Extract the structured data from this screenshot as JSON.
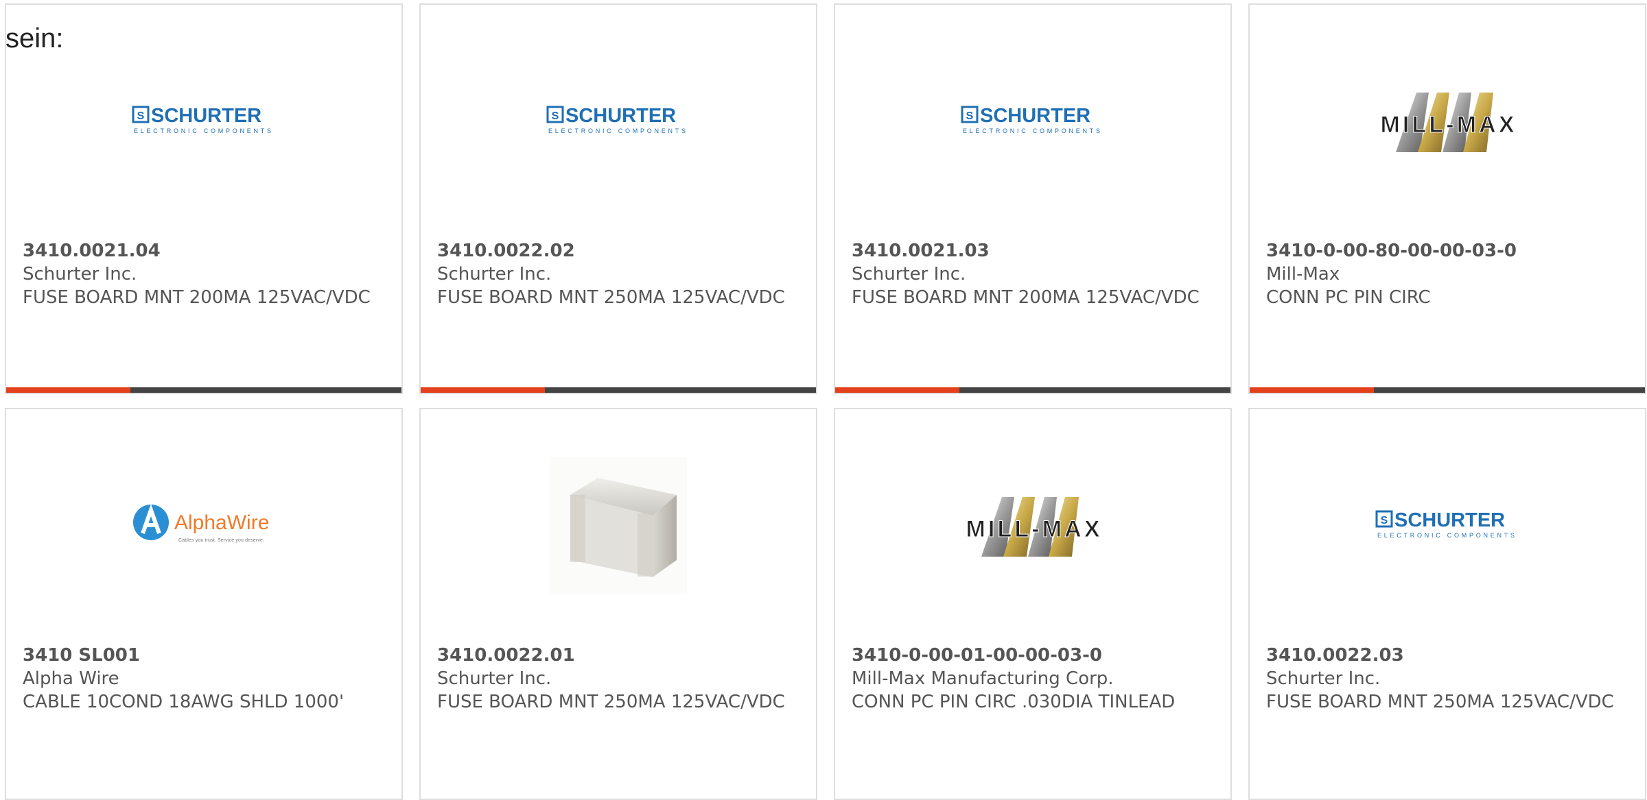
{
  "intro_text": "sein:",
  "colors": {
    "accent": "#e4401c",
    "bar": "#444444",
    "border": "#dedede",
    "text": "#555555",
    "schurter_blue": "#1f6fb5",
    "alphawire_orange": "#f07a2a",
    "alphawire_blue": "#2b8fd3"
  },
  "products": [
    {
      "part_number": "3410.0021.04",
      "manufacturer": "Schurter Inc.",
      "description": "FUSE BOARD MNT 200MA 125VAC/VDC",
      "logo": "schurter-logo",
      "logo_text": "SCHURTER",
      "logo_sub": "ELECTRONIC COMPONENTS"
    },
    {
      "part_number": "3410.0022.02",
      "manufacturer": "Schurter Inc.",
      "description": "FUSE BOARD MNT 250MA 125VAC/VDC",
      "logo": "schurter-logo",
      "logo_text": "SCHURTER",
      "logo_sub": "ELECTRONIC COMPONENTS"
    },
    {
      "part_number": "3410.0021.03",
      "manufacturer": "Schurter Inc.",
      "description": "FUSE BOARD MNT 200MA 125VAC/VDC",
      "logo": "schurter-logo",
      "logo_text": "SCHURTER",
      "logo_sub": "ELECTRONIC COMPONENTS"
    },
    {
      "part_number": "3410-0-00-80-00-00-03-0",
      "manufacturer": "Mill-Max",
      "description": "CONN PC PIN CIRC",
      "logo": "millmax-logo",
      "logo_text": "MILL-MAX"
    },
    {
      "part_number": "3410 SL001",
      "manufacturer": "Alpha Wire",
      "description": "CABLE 10COND 18AWG SHLD 1000'",
      "logo": "alphawire-logo",
      "logo_text": "AlphaWire",
      "logo_sub": "Cables you trust. Service you deserve."
    },
    {
      "part_number": "3410.0022.01",
      "manufacturer": "Schurter Inc.",
      "description": "FUSE BOARD MNT 250MA 125VAC/VDC",
      "logo": "fuse-product-photo"
    },
    {
      "part_number": "3410-0-00-01-00-00-03-0",
      "manufacturer": "Mill-Max Manufacturing Corp.",
      "description": "CONN PC PIN CIRC .030DIA TINLEAD",
      "logo": "millmax-logo",
      "logo_text": "MILL-MAX"
    },
    {
      "part_number": "3410.0022.03",
      "manufacturer": "Schurter Inc.",
      "description": "FUSE BOARD MNT 250MA 125VAC/VDC",
      "logo": "schurter-logo",
      "logo_text": "SCHURTER",
      "logo_sub": "ELECTRONIC COMPONENTS"
    }
  ]
}
